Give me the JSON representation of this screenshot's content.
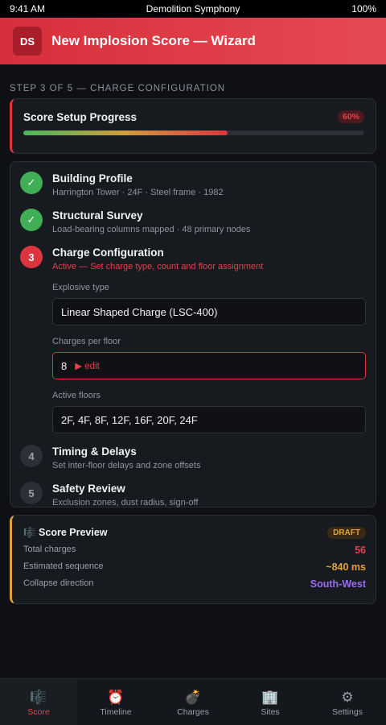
{
  "status_bar": {
    "time": "9:41 AM",
    "app_name": "Demolition Symphony",
    "battery": "100%"
  },
  "header": {
    "avatar_initials": "DS",
    "title": "New Implosion Score — Wizard"
  },
  "step_label": "STEP 3 OF 5 — CHARGE CONFIGURATION",
  "progress": {
    "title": "Score Setup Progress",
    "percent_label": "60%",
    "value": 0.6
  },
  "steps": [
    {
      "icon": "✓",
      "state": "done",
      "title": "Building Profile",
      "subtitle": "Harrington Tower · 24F · Steel frame · 1982"
    },
    {
      "icon": "✓",
      "state": "done",
      "title": "Structural Survey",
      "subtitle": "Load-bearing columns mapped · 48 primary nodes"
    },
    {
      "icon": "3",
      "state": "active",
      "title": "Charge Configuration",
      "subtitle": "Active — Set charge type, count and floor assignment"
    },
    {
      "icon": "4",
      "state": "todo",
      "title": "Timing & Delays",
      "subtitle": "Set inter-floor delays and zone offsets"
    },
    {
      "icon": "5",
      "state": "todo",
      "title": "Safety Review",
      "subtitle": "Exclusion zones, dust radius, sign-off"
    }
  ],
  "form": {
    "explosive_type_label": "Explosive type",
    "explosive_type_value": "Linear Shaped Charge (LSC-400)",
    "charges_label": "Charges per floor",
    "charges_value": "8",
    "charges_edit": "▶ edit",
    "floors_label": "Active floors",
    "floors_value": "2F, 4F, 8F, 12F, 16F, 20F, 24F"
  },
  "preview": {
    "title": "🎼 Score Preview",
    "badge": "DRAFT",
    "rows": [
      {
        "label": "Total charges",
        "value": "56",
        "color": "#e2434d"
      },
      {
        "label": "Estimated sequence",
        "value": "~840 ms",
        "color": "#e0a13c"
      },
      {
        "label": "Collapse direction",
        "value": "South-West",
        "color": "#9b6cf0"
      }
    ]
  },
  "nav": [
    {
      "icon": "🎼",
      "label": "Score"
    },
    {
      "icon": "⏰",
      "label": "Timeline"
    },
    {
      "icon": "💣",
      "label": "Charges"
    },
    {
      "icon": "🏢",
      "label": "Sites"
    },
    {
      "icon": "⚙",
      "label": "Settings"
    }
  ],
  "colors": {
    "accent": "#dd3540",
    "success": "#3fae55",
    "warning": "#e0a13c",
    "purple": "#9b6cf0"
  }
}
